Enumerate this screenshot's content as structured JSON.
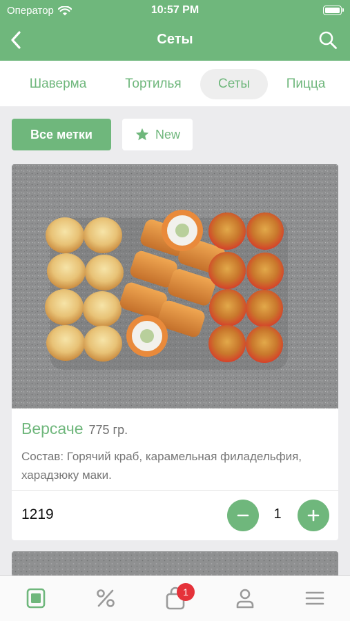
{
  "status_bar": {
    "carrier": "Оператор",
    "time": "10:57 PM"
  },
  "nav": {
    "title": "Сеты"
  },
  "category_tabs": [
    {
      "label": "Шаверма",
      "active": false
    },
    {
      "label": "Тортилья",
      "active": false
    },
    {
      "label": "Сеты",
      "active": true
    },
    {
      "label": "Пицца",
      "active": false
    }
  ],
  "filters": {
    "all_tags": "Все метки",
    "new_tag": "New"
  },
  "product": {
    "name": "Версаче",
    "weight": "775 гр.",
    "description": "Состав: Горячий краб, карамельная филадельфия, харадзюку маки.",
    "price": "1219",
    "quantity": "1"
  },
  "tab_bar": {
    "items": [
      "menu-icon",
      "percent-icon",
      "cart-icon",
      "profile-icon",
      "hamburger-icon"
    ],
    "cart_badge": "1"
  },
  "colors": {
    "brand_green": "#6fb77c",
    "badge_red": "#e5323a"
  }
}
